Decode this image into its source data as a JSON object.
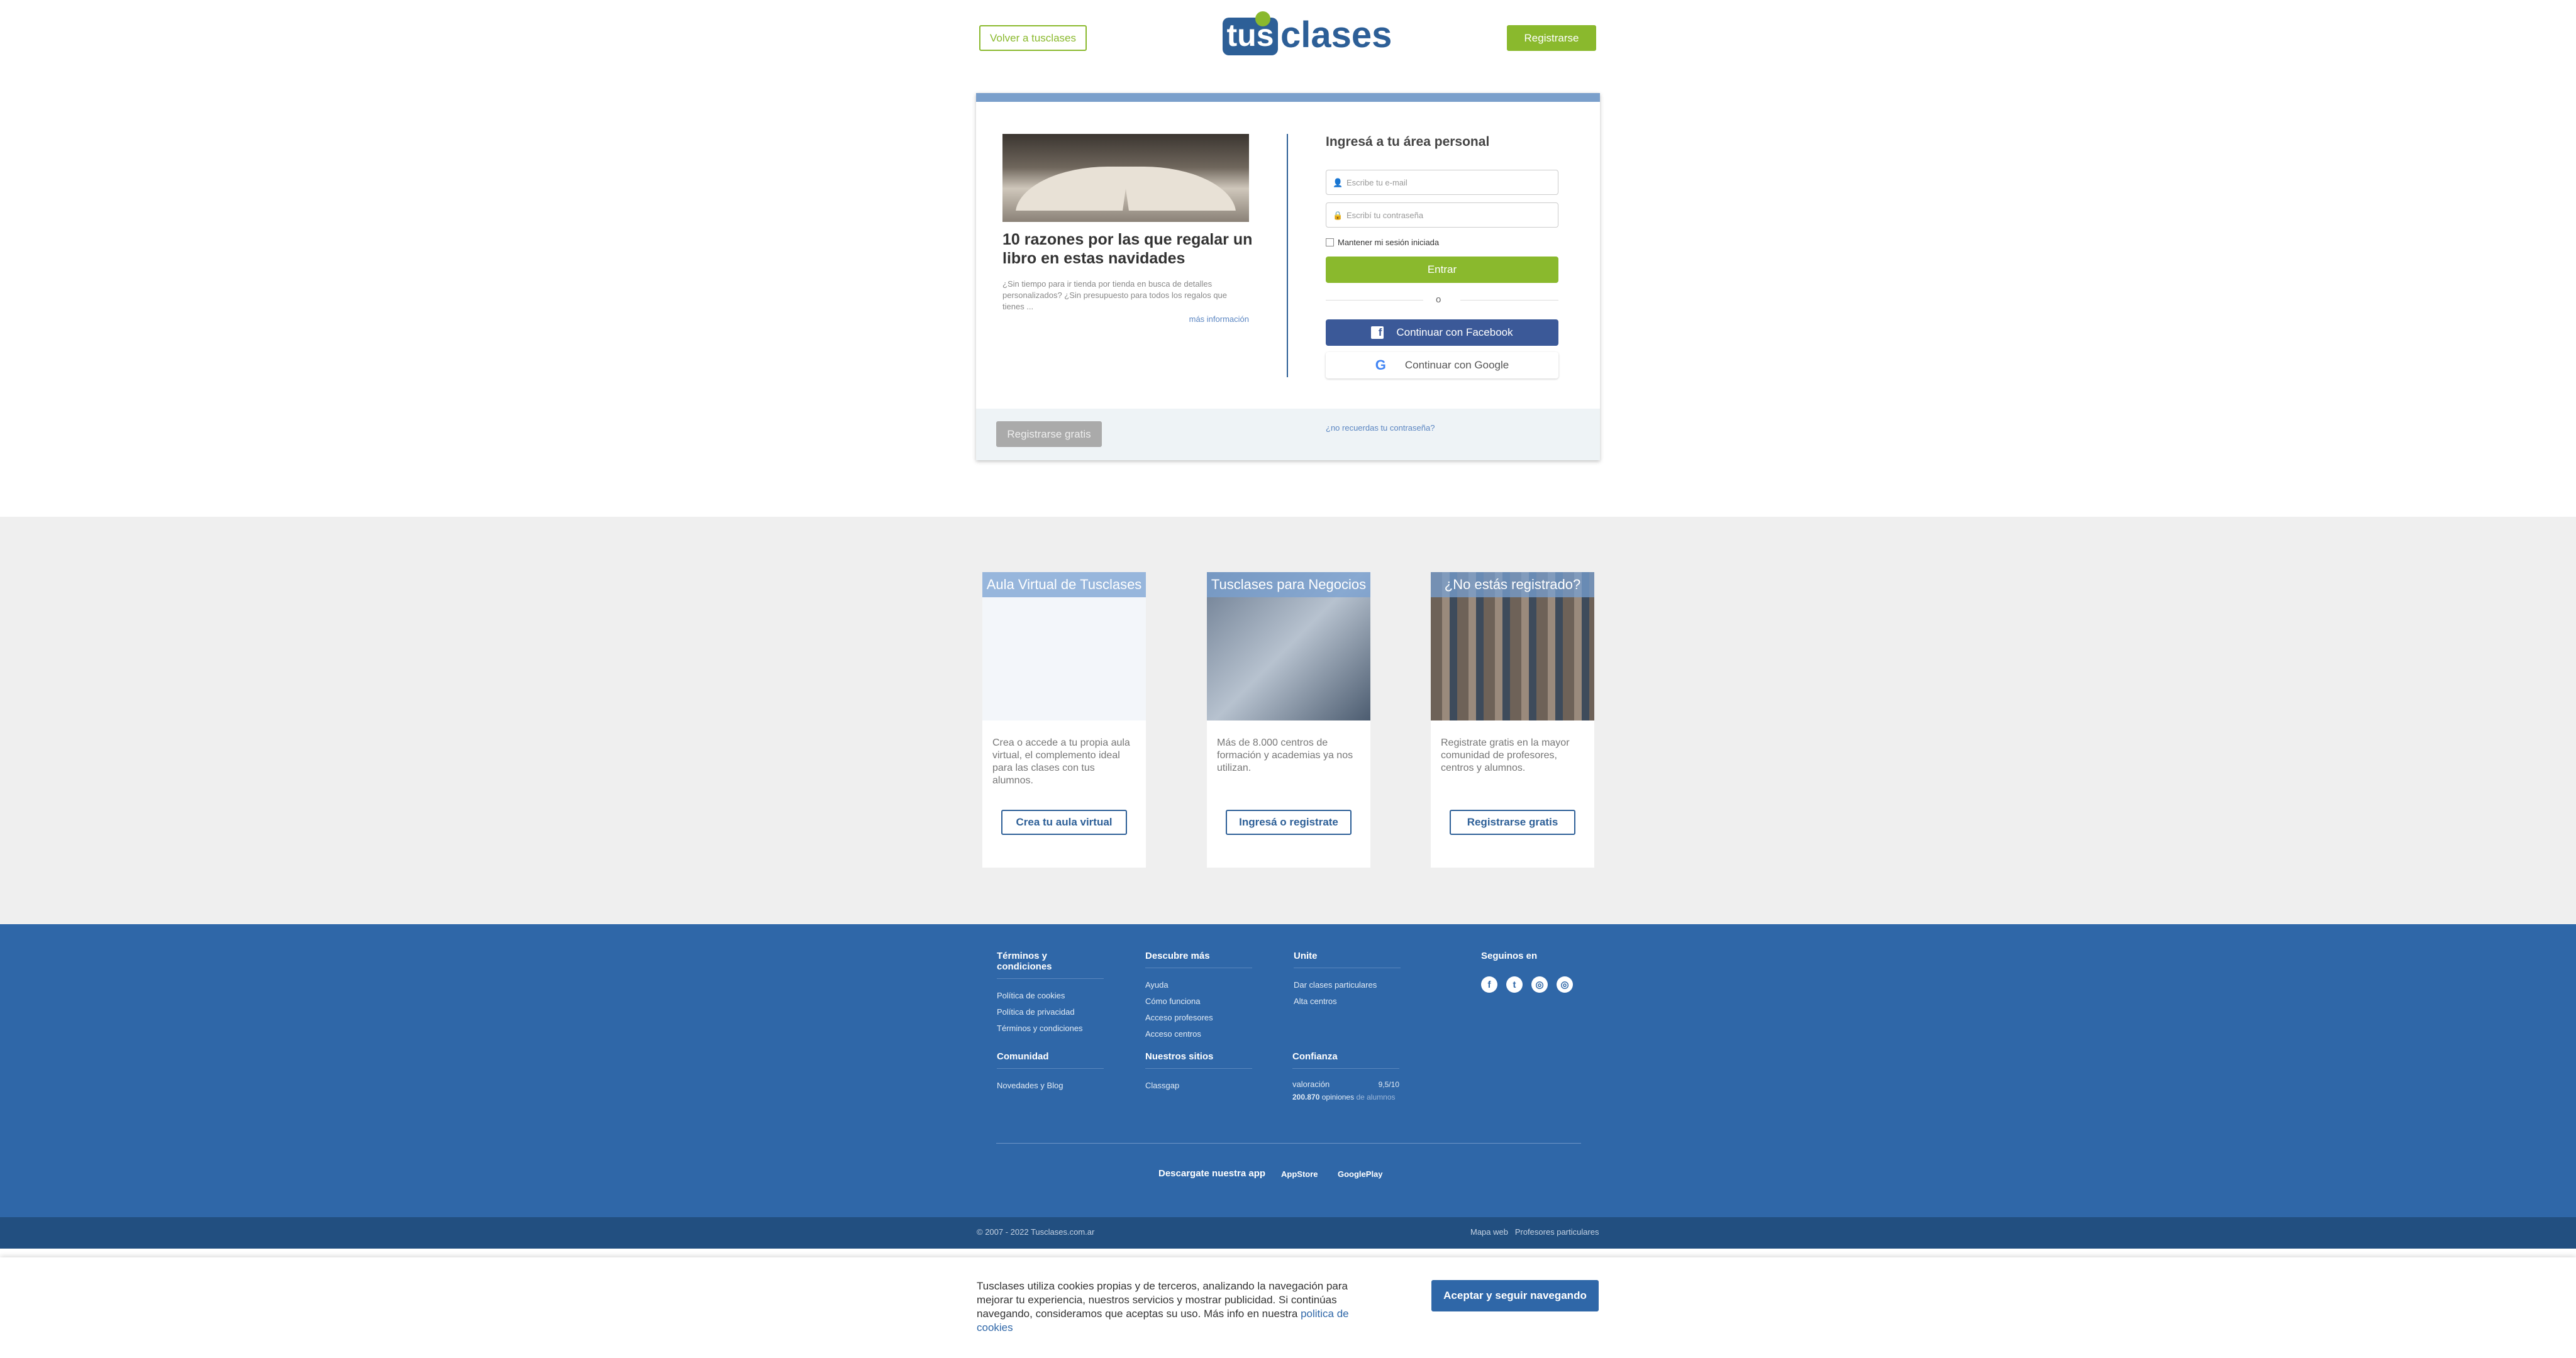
{
  "header": {
    "back_label": "Volver a tusclases",
    "logo_tus": "tus",
    "logo_clases": "clases",
    "register_label": "Registrarse"
  },
  "promo": {
    "title": "10 razones por las que regalar un libro en estas navidades",
    "text": "¿Sin tiempo para ir tienda por tienda en busca de detalles personalizados? ¿Sin presupuesto para todos los regalos que tienes ...",
    "more": "más información"
  },
  "login": {
    "title": "Ingresá a tu área personal",
    "email_placeholder": "Escribe tu e-mail",
    "password_placeholder": "Escribí tu contraseña",
    "remember": "Mantener mi sesión iniciada",
    "enter": "Entrar",
    "or": "o",
    "facebook": "Continuar con Facebook",
    "google": "Continuar con Google",
    "register_free": "Registrarse gratis",
    "forgot": "¿no recuerdas tu contraseña?"
  },
  "features": [
    {
      "title": "Aula Virtual de Tusclases",
      "text": "Crea o accede a tu propia aula virtual, el complemento ideal para las clases con tus alumnos.",
      "button": "Crea tu aula virtual"
    },
    {
      "title": "Tusclases para Negocios",
      "text": "Más de 8.000 centros de formación y academias ya nos utilizan.",
      "button": "Ingresá o registrate"
    },
    {
      "title": "¿No estás registrado?",
      "text": "Registrate gratis en la mayor comunidad de profesores, centros y alumnos.",
      "button": "Registrarse gratis"
    }
  ],
  "footer": {
    "terms": {
      "title": "Términos y condiciones",
      "links": [
        "Política de cookies",
        "Política de privacidad",
        "Términos y condiciones"
      ]
    },
    "discover": {
      "title": "Descubre más",
      "links": [
        "Ayuda",
        "Cómo funciona",
        "Acceso profesores",
        "Acceso centros"
      ]
    },
    "join": {
      "title": "Unite",
      "links": [
        "Dar clases particulares",
        "Alta centros"
      ]
    },
    "follow": {
      "title": "Seguinos en",
      "icons": [
        "facebook-icon",
        "twitter-icon",
        "instagram-icon",
        "instagram-icon"
      ]
    },
    "community": {
      "title": "Comunidad",
      "links": [
        "Novedades y Blog"
      ]
    },
    "sites": {
      "title": "Nuestros sitios",
      "links": [
        "Classgap"
      ]
    },
    "trust": {
      "title": "Confianza",
      "rating_alt": "valoración",
      "score": "9,5/10",
      "count": "200.870",
      "opinions": "opiniones",
      "of_students": "de alumnos"
    },
    "app_label": "Descargate nuestra app",
    "appstore": "AppStore",
    "googleplay": "GooglePlay",
    "copyright": "© 2007 - 2022 Tusclases.com.ar",
    "sitemap": "Mapa web",
    "teachers": "Profesores particulares"
  },
  "cookie": {
    "text": "Tusclases utiliza cookies propias y de terceros, analizando la navegación para mejorar tu experiencia, nuestros servicios y mostrar publicidad. Si continúas navegando, consideramos que aceptas su uso. Más info en nuestra",
    "link": "politica de cookies",
    "accept": "Aceptar y seguir navegando"
  },
  "colors": {
    "brand_blue": "#2f67a8",
    "brand_green": "#8ab92d"
  }
}
